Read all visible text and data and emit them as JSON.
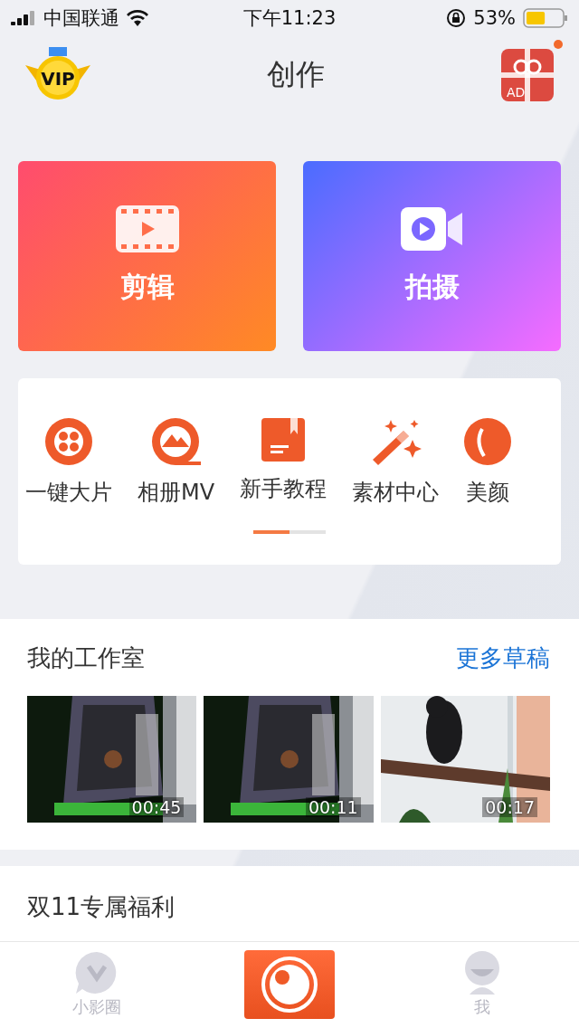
{
  "status_bar": {
    "carrier": "中国联通",
    "time": "下午11:23",
    "battery_text": "53%"
  },
  "header": {
    "title": "创作",
    "vip_badge": "VIP",
    "gift_badge": "AD",
    "gift_notification": true
  },
  "main_actions": [
    {
      "kind": "edit",
      "label": "剪辑"
    },
    {
      "kind": "shoot",
      "label": "拍摄"
    }
  ],
  "tools": [
    {
      "kind": "film",
      "label": "一键大片"
    },
    {
      "kind": "album",
      "label": "相册MV"
    },
    {
      "kind": "book",
      "label": "新手教程"
    },
    {
      "kind": "wand",
      "label": "素材中心"
    },
    {
      "kind": "face",
      "label": "美颜"
    }
  ],
  "tool_pages": [
    {
      "selected": true
    },
    {
      "selected": false
    }
  ],
  "studio": {
    "title": "我的工作室",
    "more_link": "更多草稿",
    "drafts": [
      {
        "kind": "cage",
        "duration": "00:45"
      },
      {
        "kind": "cage",
        "duration": "00:11"
      },
      {
        "kind": "bird",
        "duration": "00:17"
      }
    ]
  },
  "promo": {
    "title": "双11专属福利"
  },
  "bottom_nav": [
    {
      "kind": "circle",
      "label": "小影圈"
    },
    {
      "kind": "camera"
    },
    {
      "kind": "me",
      "label": "我"
    }
  ]
}
